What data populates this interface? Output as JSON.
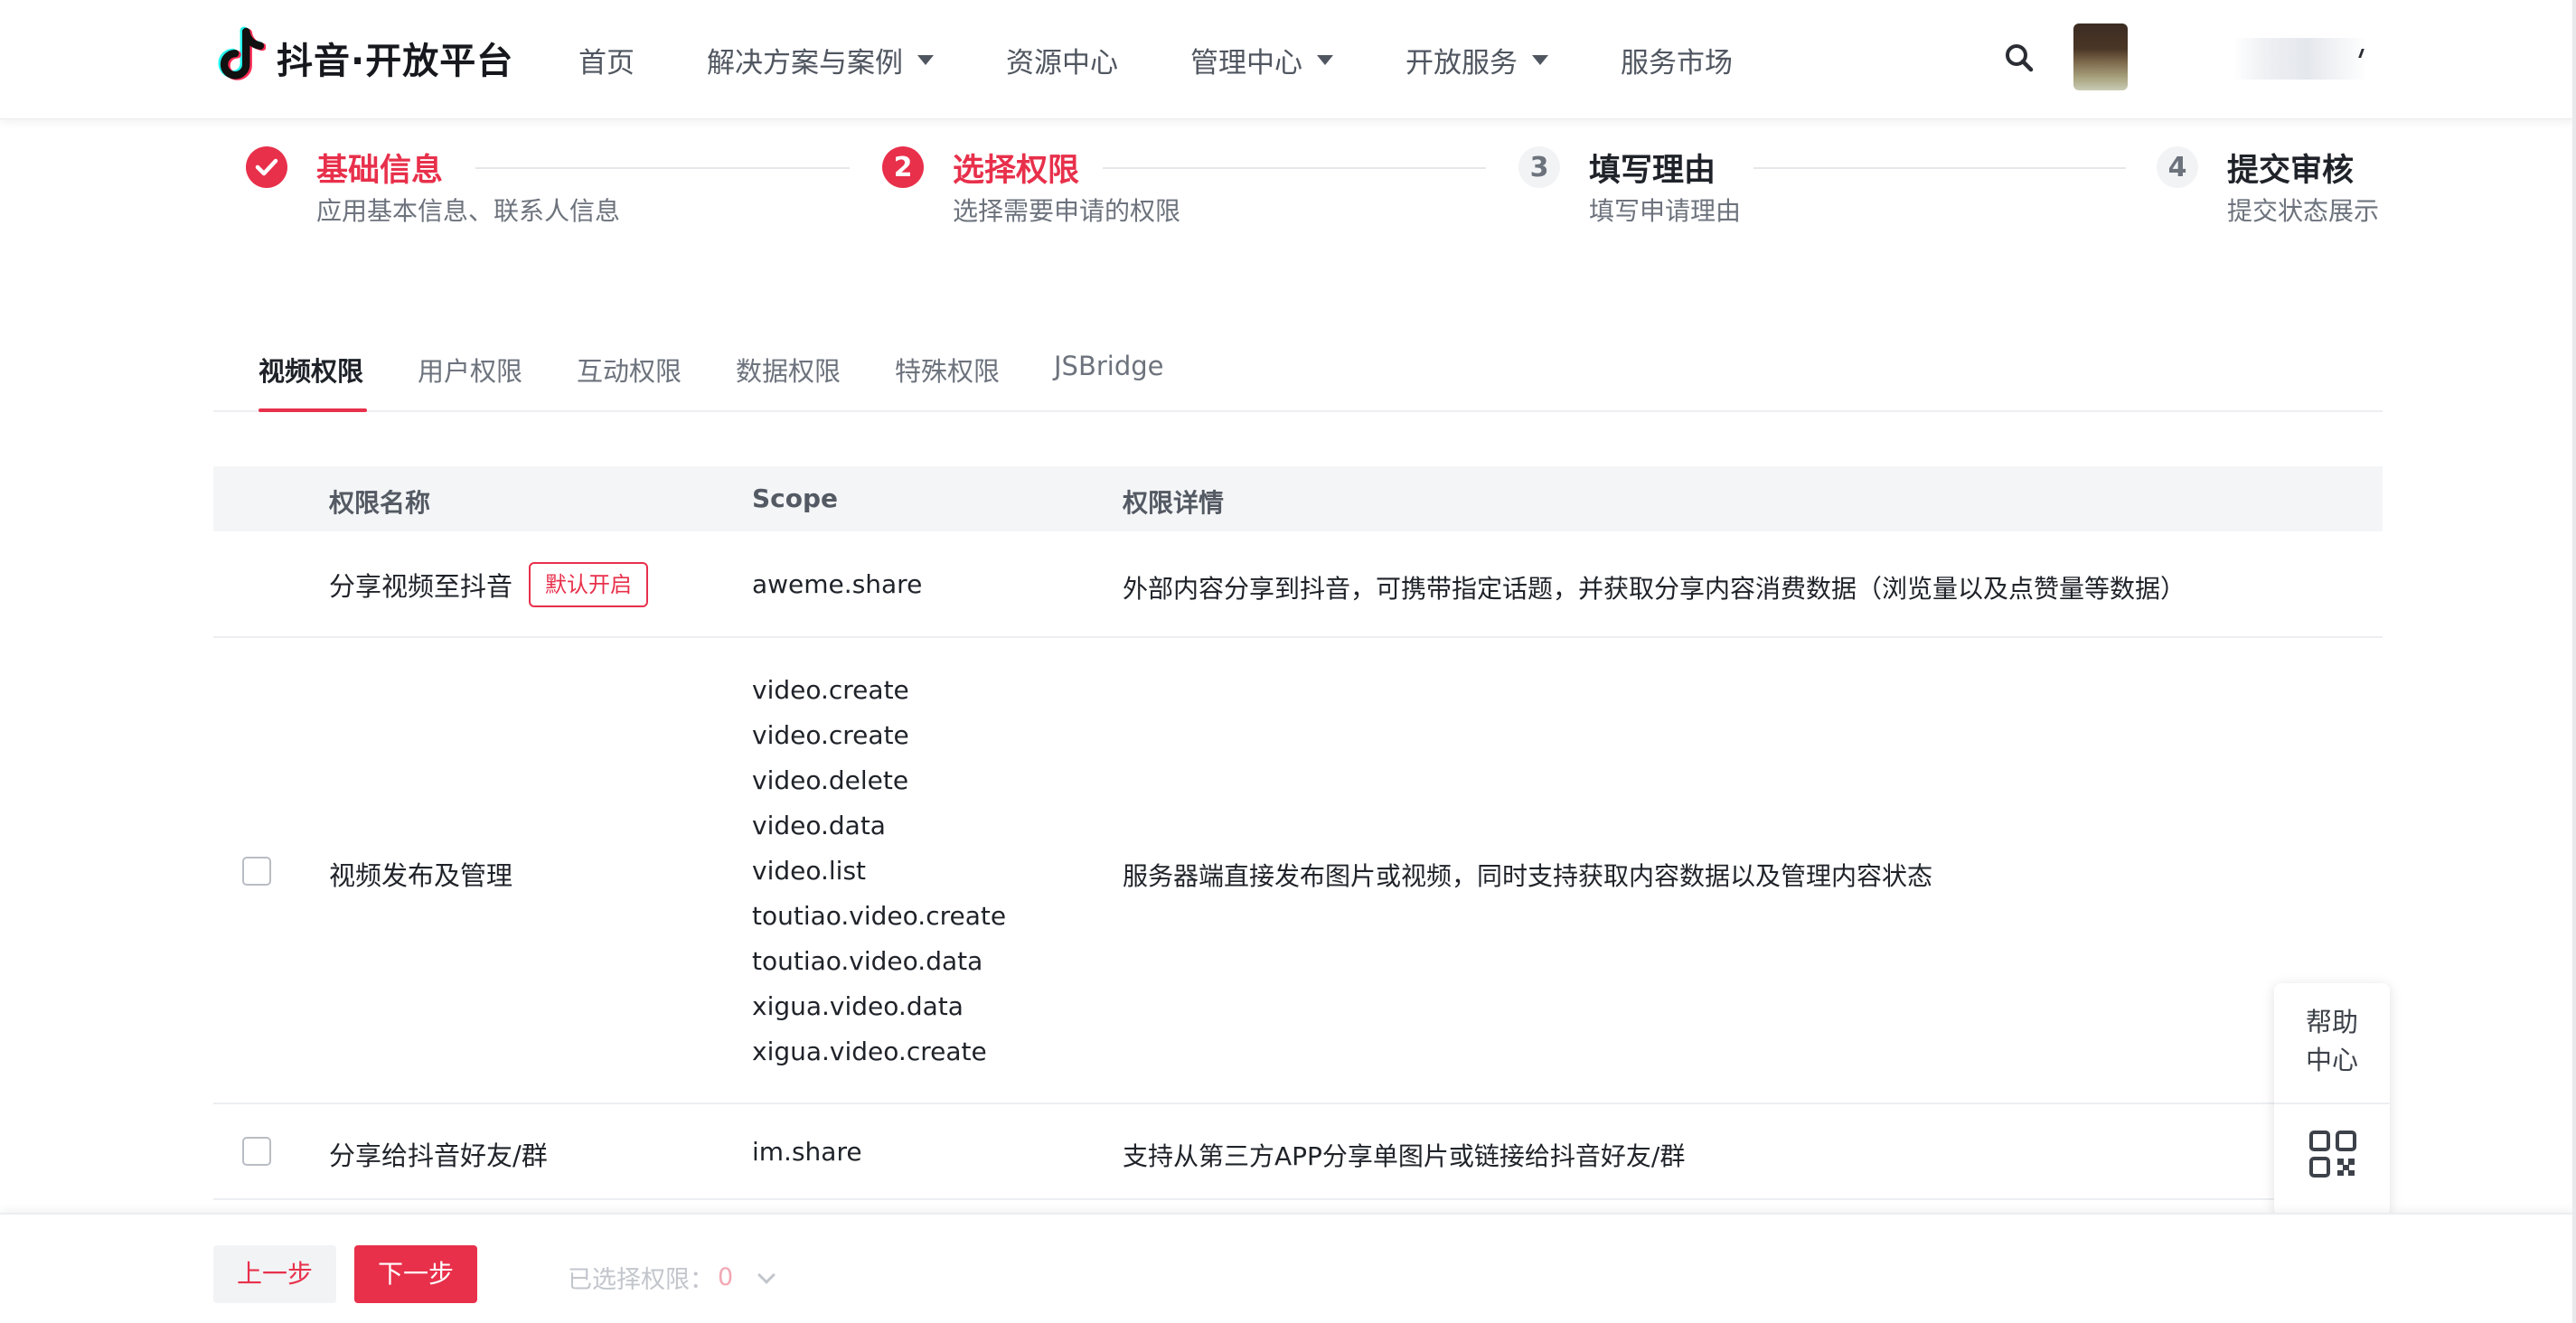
{
  "brand": {
    "logo_text": "抖音·开放平台"
  },
  "nav": {
    "items": [
      {
        "label": "首页",
        "has_dropdown": false
      },
      {
        "label": "解决方案与案例",
        "has_dropdown": true
      },
      {
        "label": "资源中心",
        "has_dropdown": false
      },
      {
        "label": "管理中心",
        "has_dropdown": true
      },
      {
        "label": "开放服务",
        "has_dropdown": true
      },
      {
        "label": "服务市场",
        "has_dropdown": false
      }
    ]
  },
  "steps": [
    {
      "number": "1",
      "title": "基础信息",
      "subtitle": "应用基本信息、联系人信息",
      "status": "done"
    },
    {
      "number": "2",
      "title": "选择权限",
      "subtitle": "选择需要申请的权限",
      "status": "active"
    },
    {
      "number": "3",
      "title": "填写理由",
      "subtitle": "填写申请理由",
      "status": "wait"
    },
    {
      "number": "4",
      "title": "提交审核",
      "subtitle": "提交状态展示",
      "status": "wait"
    }
  ],
  "tabs": [
    {
      "label": "视频权限",
      "active": true
    },
    {
      "label": "用户权限",
      "active": false
    },
    {
      "label": "互动权限",
      "active": false
    },
    {
      "label": "数据权限",
      "active": false
    },
    {
      "label": "特殊权限",
      "active": false
    },
    {
      "label": "JSBridge",
      "active": false
    }
  ],
  "table": {
    "headers": {
      "name": "权限名称",
      "scope": "Scope",
      "detail": "权限详情"
    },
    "rows": [
      {
        "name": "分享视频至抖音",
        "tag": "默认开启",
        "has_checkbox": false,
        "scopes": [
          "aweme.share"
        ],
        "detail": "外部内容分享到抖音，可携带指定话题，并获取分享内容消费数据（浏览量以及点赞量等数据）"
      },
      {
        "name": "视频发布及管理",
        "tag": "",
        "has_checkbox": true,
        "scopes": [
          "video.create",
          "video.create",
          "video.delete",
          "video.data",
          "video.list",
          "toutiao.video.create",
          "toutiao.video.data",
          "xigua.video.data",
          "xigua.video.create"
        ],
        "detail": "服务器端直接发布图片或视频，同时支持获取内容数据以及管理内容状态"
      },
      {
        "name": "分享给抖音好友/群",
        "tag": "",
        "has_checkbox": true,
        "scopes": [
          "im.share"
        ],
        "detail": "支持从第三方APP分享单图片或链接给抖音好友/群"
      }
    ]
  },
  "help": {
    "line1": "帮助",
    "line2": "中心"
  },
  "footer": {
    "prev_label": "上一步",
    "next_label": "下一步",
    "selected_label": "已选择权限：",
    "selected_count": "0"
  },
  "colors": {
    "accent": "#e8304b",
    "text_primary": "#1f2329",
    "text_secondary": "#6d737d"
  },
  "icons": {
    "search": "search-icon",
    "help_qr": "qr-code-icon",
    "step_done": "check-icon"
  }
}
